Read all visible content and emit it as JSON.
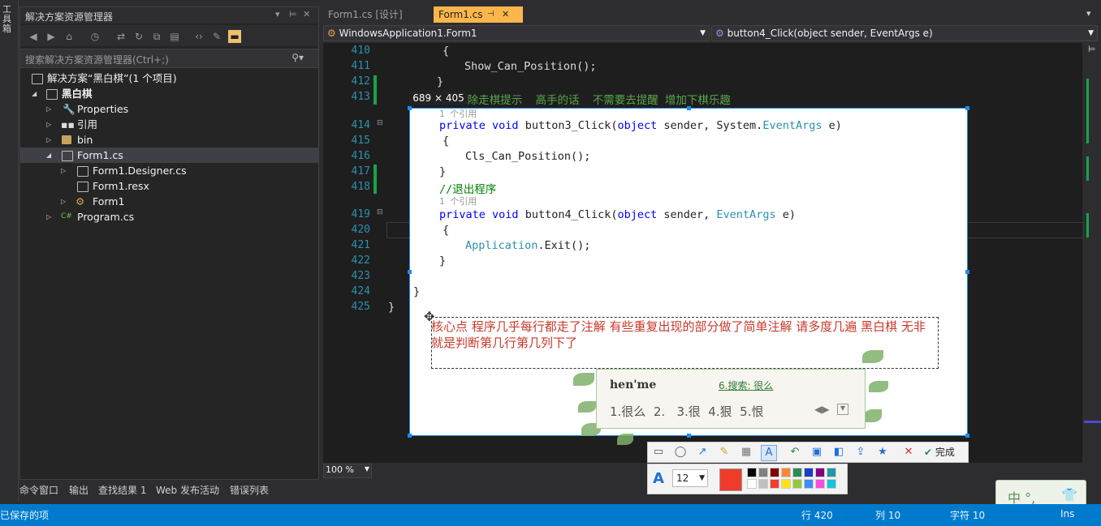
{
  "toolbox_strip": {
    "label": "工具箱"
  },
  "solution_explorer": {
    "title": "解决方案资源管理器",
    "search_placeholder": "搜索解决方案资源管理器(Ctrl+;)",
    "tree": [
      {
        "label": "解决方案“黑白棋”(1 个项目)",
        "icon": "solution-icon"
      },
      {
        "label": "黑白棋",
        "icon": "csharp-project-icon",
        "bold": true
      },
      {
        "label": "Properties",
        "icon": "wrench-icon"
      },
      {
        "label": "引用",
        "icon": "references-icon"
      },
      {
        "label": "bin",
        "icon": "folder-icon"
      },
      {
        "label": "Form1.cs",
        "icon": "form-icon",
        "selected": true
      },
      {
        "label": "Form1.Designer.cs",
        "icon": "cs-file-icon"
      },
      {
        "label": "Form1.resx",
        "icon": "resx-file-icon"
      },
      {
        "label": "Form1",
        "icon": "class-icon"
      },
      {
        "label": "Program.cs",
        "icon": "csharp-file-icon"
      }
    ]
  },
  "editor": {
    "tabs": [
      {
        "label": "Form1.cs [设计]",
        "active": false
      },
      {
        "label": "Form1.cs",
        "active": true
      }
    ],
    "nav_left": "WindowsApplication1.Form1",
    "nav_right": "button4_Click(object sender, EventArgs e)",
    "zoom": "100 %",
    "line_numbers": [
      "410",
      "411",
      "412",
      "413",
      "414",
      "415",
      "416",
      "417",
      "418",
      "419",
      "420",
      "421",
      "422",
      "423",
      "424",
      "425"
    ],
    "lines": {
      "l410": "{",
      "l411": "Show_Can_Position();",
      "l412": "}",
      "l413": "//删除走棋提示  高手的话  不需要去提醒 增加下棋乐趣",
      "ref1": "1 个引用",
      "l414_a": "private",
      "l414_b": "void",
      "l414_c": " button3_Click(",
      "l414_d": "object",
      "l414_e": " sender, System.",
      "l414_f": "EventArgs",
      "l414_g": " e)",
      "l415": "{",
      "l416": "Cls_Can_Position();",
      "l417": "}",
      "l418": "//退出程序",
      "ref2": "1 个引用",
      "l419_a": "private",
      "l419_b": "void",
      "l419_c": " button4_Click(",
      "l419_d": "object",
      "l419_e": " sender, ",
      "l419_f": "EventArgs",
      "l419_g": " e)",
      "l420": "{",
      "l421_a": "Application",
      "l421_b": ".Exit();",
      "l422": "}",
      "l424": "}",
      "l425": "}"
    }
  },
  "snip": {
    "size_label": "689 × 405",
    "note": "核心点  程序几乎每行都走了注解  有些重复出现的部分做了简单注解  请多度几遍 黑白棋 无非就是判断第几行第几列下了",
    "done_label": "完成",
    "font_size": "12",
    "current_color": "#ef3b2a",
    "palette": [
      "#000000",
      "#808080",
      "#800000",
      "#f7883a",
      "#2e8b57",
      "#1a3fbf",
      "#800080",
      "#1e9aa6",
      "#ffffff",
      "#c0c0c0",
      "#f23d2d",
      "#ffe21a",
      "#92c83e",
      "#3d8ef0",
      "#f54ee0",
      "#19c3d8"
    ]
  },
  "ime": {
    "pinyin": "hen'me",
    "search": "6.搜索: 很么",
    "candidates": "1.很么  2.   3.很  4.狠  5.恨",
    "mini": "中 °,"
  },
  "bottom_tabs": [
    "命令窗口",
    "输出",
    "查找结果 1",
    "Web 发布活动",
    "错误列表"
  ],
  "status": {
    "left": "已保存的项",
    "row": "行 420",
    "col": "列 10",
    "char": "字符 10",
    "mode": "Ins"
  },
  "colors": {
    "accent": "#007acc",
    "tab_active": "#fcb64b",
    "snip_border": "#1f8ceb"
  }
}
